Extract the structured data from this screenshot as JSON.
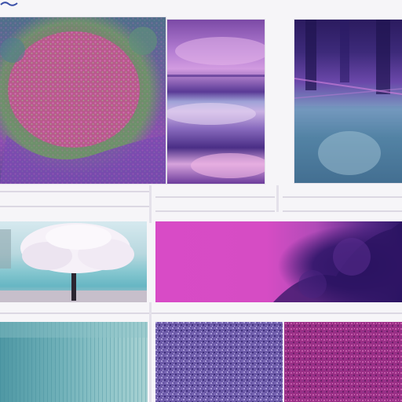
{
  "collage": {
    "tiles": [
      {
        "id": "flower-field",
        "subject": ""
      },
      {
        "id": "purple-sky",
        "subject": ""
      },
      {
        "id": "flooded-interior",
        "subject": ""
      },
      {
        "id": "blossom-tree",
        "subject": ""
      },
      {
        "id": "pink-abstract",
        "subject": ""
      },
      {
        "id": "teal-texture",
        "subject": ""
      },
      {
        "id": "violet-noise",
        "subject": ""
      },
      {
        "id": "magenta-noise",
        "subject": ""
      }
    ],
    "palette": {
      "background": "#f6f5f8",
      "magenta": "#d84bc6",
      "violet": "#6c5aa8",
      "indigo": "#2d1565",
      "teal": "#6fb0b8",
      "blossom": "#f3eef6"
    }
  }
}
